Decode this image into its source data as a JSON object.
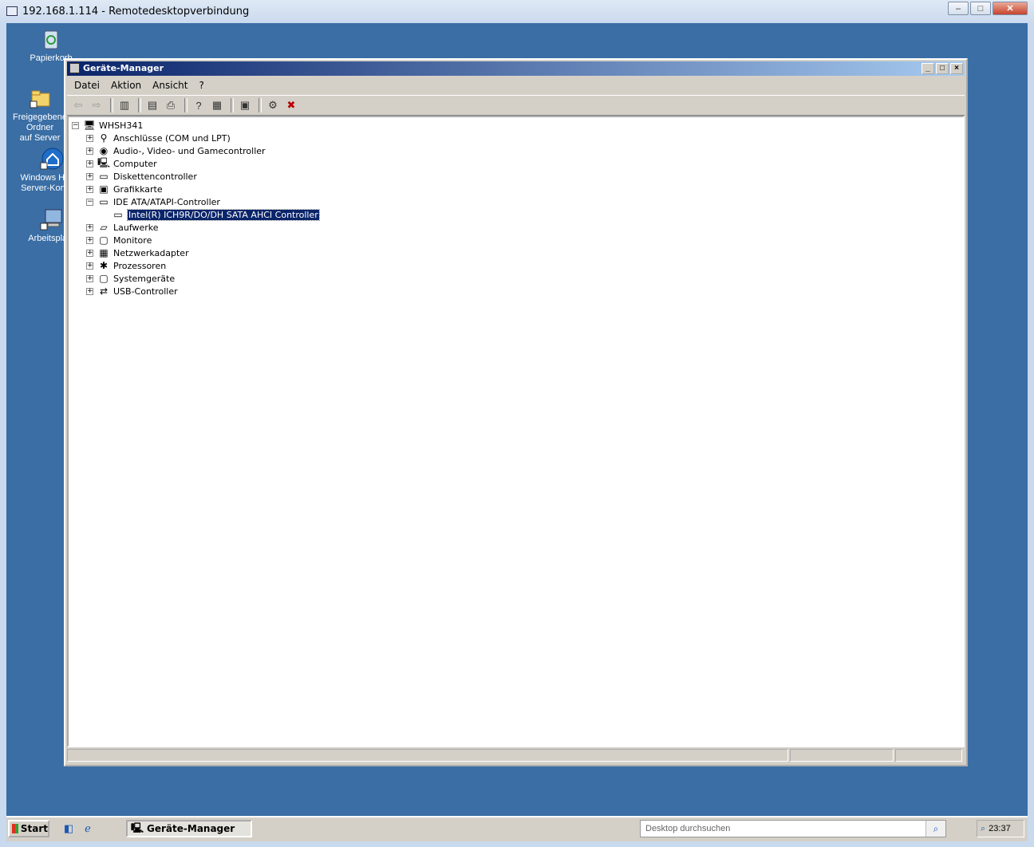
{
  "rdp": {
    "title": "192.168.1.114 - Remotedesktopverbindung",
    "buttons": {
      "minimize": "–",
      "maximize": "□",
      "close": "✕"
    }
  },
  "desktop_icons": [
    {
      "label1": "Papierkorb",
      "label2": "",
      "icon": "recycle-bin-icon"
    },
    {
      "label1": "Freigegebene Ordner",
      "label2": "auf Server",
      "icon": "shared-folders-icon"
    },
    {
      "label1": "Windows Home",
      "label2": "Server-Konsole",
      "icon": "whs-console-icon"
    },
    {
      "label1": "Arbeitsplatz",
      "label2": "",
      "icon": "my-computer-icon"
    }
  ],
  "window": {
    "title": "Geräte-Manager",
    "menu": [
      "Datei",
      "Aktion",
      "Ansicht",
      "?"
    ],
    "toolbar": [
      "back-icon",
      "forward-icon",
      "show-hide-tree-icon",
      "properties-icon",
      "print-icon",
      "help-icon",
      "view-icon",
      "update-driver-icon",
      "scan-hardware-icon",
      "uninstall-icon"
    ]
  },
  "tree": {
    "root": "WHSH341",
    "items": [
      {
        "label": "Anschlüsse (COM und LPT)",
        "expander": "+",
        "icon": "port-icon"
      },
      {
        "label": "Audio-, Video- und Gamecontroller",
        "expander": "+",
        "icon": "audio-icon"
      },
      {
        "label": "Computer",
        "expander": "+",
        "icon": "computer-icon"
      },
      {
        "label": "Diskettencontroller",
        "expander": "+",
        "icon": "floppy-controller-icon"
      },
      {
        "label": "Grafikkarte",
        "expander": "+",
        "icon": "display-adapter-icon"
      },
      {
        "label": "IDE ATA/ATAPI-Controller",
        "expander": "−",
        "icon": "ide-controller-icon"
      },
      {
        "label": "Intel(R) ICH9R/DO/DH SATA AHCI Controller",
        "expander": "",
        "icon": "ide-controller-icon",
        "child": true,
        "selected": true
      },
      {
        "label": "Laufwerke",
        "expander": "+",
        "icon": "disk-drive-icon"
      },
      {
        "label": "Monitore",
        "expander": "+",
        "icon": "monitor-icon"
      },
      {
        "label": "Netzwerkadapter",
        "expander": "+",
        "icon": "network-adapter-icon"
      },
      {
        "label": "Prozessoren",
        "expander": "+",
        "icon": "processor-icon"
      },
      {
        "label": "Systemgeräte",
        "expander": "+",
        "icon": "system-devices-icon"
      },
      {
        "label": "USB-Controller",
        "expander": "+",
        "icon": "usb-icon"
      }
    ]
  },
  "taskbar": {
    "start": "Start",
    "task": "Geräte-Manager",
    "search_placeholder": "Desktop durchsuchen",
    "clock": "23:37"
  }
}
